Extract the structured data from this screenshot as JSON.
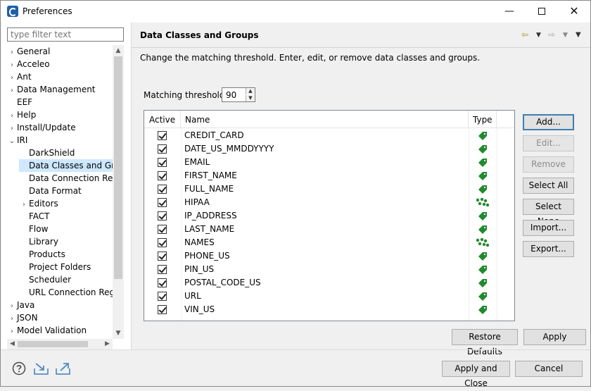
{
  "window": {
    "title": "Preferences",
    "controls": {
      "minimize": "—",
      "close": "✕"
    }
  },
  "left": {
    "filter_placeholder": "type filter text",
    "tree": [
      {
        "label": "General",
        "twisty": "›",
        "level": 0
      },
      {
        "label": "Acceleo",
        "twisty": "›",
        "level": 0
      },
      {
        "label": "Ant",
        "twisty": "›",
        "level": 0
      },
      {
        "label": "Data Management",
        "twisty": "›",
        "level": 0
      },
      {
        "label": "EEF",
        "twisty": "",
        "level": 0
      },
      {
        "label": "Help",
        "twisty": "›",
        "level": 0
      },
      {
        "label": "Install/Update",
        "twisty": "›",
        "level": 0
      },
      {
        "label": "IRI",
        "twisty": "⌄",
        "level": 0
      },
      {
        "label": "DarkShield",
        "twisty": "",
        "level": 1
      },
      {
        "label": "Data Classes and Groups",
        "twisty": "",
        "level": 1,
        "selected": true
      },
      {
        "label": "Data Connection Registry",
        "twisty": "",
        "level": 1
      },
      {
        "label": "Data Format",
        "twisty": "",
        "level": 1
      },
      {
        "label": "Editors",
        "twisty": "›",
        "level": 1
      },
      {
        "label": "FACT",
        "twisty": "",
        "level": 1
      },
      {
        "label": "Flow",
        "twisty": "",
        "level": 1
      },
      {
        "label": "Library",
        "twisty": "",
        "level": 1
      },
      {
        "label": "Products",
        "twisty": "",
        "level": 1
      },
      {
        "label": "Project Folders",
        "twisty": "",
        "level": 1
      },
      {
        "label": "Scheduler",
        "twisty": "",
        "level": 1
      },
      {
        "label": "URL Connection Registry",
        "twisty": "",
        "level": 1
      },
      {
        "label": "Java",
        "twisty": "›",
        "level": 0
      },
      {
        "label": "JSON",
        "twisty": "›",
        "level": 0
      },
      {
        "label": "Model Validation",
        "twisty": "›",
        "level": 0
      }
    ]
  },
  "page": {
    "title": "Data Classes and Groups",
    "description": "Change the matching threshold. Enter, edit, or remove data classes and groups.",
    "threshold_label": "Matching threshold:",
    "threshold_value": "90",
    "columns": {
      "active": "Active",
      "name": "Name",
      "type": "Type"
    },
    "rows": [
      {
        "name": "CREDIT_CARD",
        "active": true,
        "type": "class"
      },
      {
        "name": "DATE_US_MMDDYYYY",
        "active": true,
        "type": "class"
      },
      {
        "name": "EMAIL",
        "active": true,
        "type": "class"
      },
      {
        "name": "FIRST_NAME",
        "active": true,
        "type": "class"
      },
      {
        "name": "FULL_NAME",
        "active": true,
        "type": "class"
      },
      {
        "name": "HIPAA",
        "active": true,
        "type": "group"
      },
      {
        "name": "IP_ADDRESS",
        "active": true,
        "type": "class"
      },
      {
        "name": "LAST_NAME",
        "active": true,
        "type": "class"
      },
      {
        "name": "NAMES",
        "active": true,
        "type": "group"
      },
      {
        "name": "PHONE_US",
        "active": true,
        "type": "class"
      },
      {
        "name": "PIN_US",
        "active": true,
        "type": "class"
      },
      {
        "name": "POSTAL_CODE_US",
        "active": true,
        "type": "class"
      },
      {
        "name": "URL",
        "active": true,
        "type": "class"
      },
      {
        "name": "VIN_US",
        "active": true,
        "type": "class"
      }
    ],
    "buttons": {
      "add": "Add...",
      "edit": "Edit...",
      "remove": "Remove",
      "select_all": "Select All",
      "select_none": "Select None",
      "import": "Import...",
      "export": "Export..."
    },
    "restore_defaults": "Restore Defaults",
    "apply": "Apply"
  },
  "footer": {
    "apply_and_close": "Apply and Close",
    "cancel": "Cancel"
  },
  "icons": {
    "help": "help-icon",
    "import": "import-preferences-icon",
    "export": "export-preferences-icon",
    "tag_color": "#1f8a2e",
    "nav_back_color": "#c8961e"
  }
}
